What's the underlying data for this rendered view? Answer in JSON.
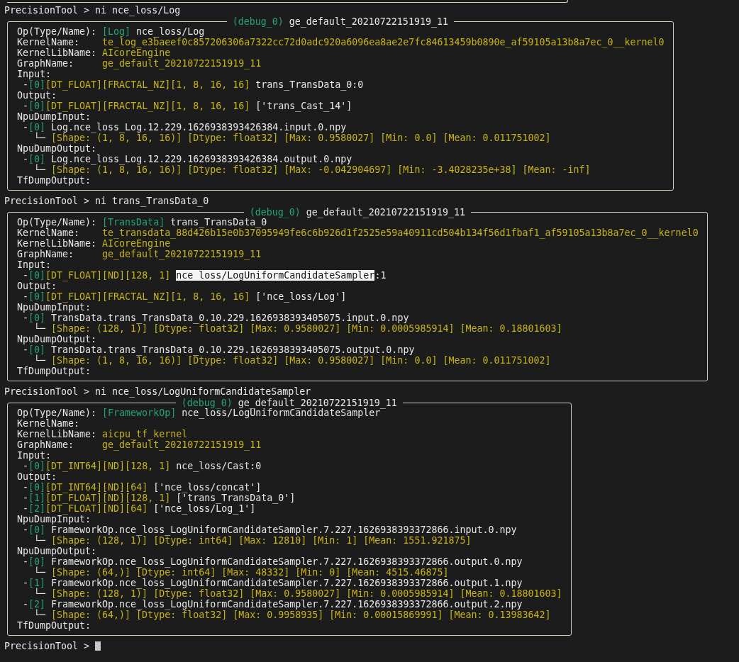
{
  "entries": [
    {
      "line": "PrecisionTool > ni nce_loss/Log",
      "panel": {
        "tag": "(debug_0)",
        "graph": "ge_default_20210722151919_11",
        "lines": [
          {
            "kind": "field",
            "parts": [
              {
                "kind": "label",
                "text": "Op(Type/Name):"
              },
              {
                "kind": "type",
                "text": "[Log]"
              },
              {
                "kind": "text",
                "text": "nce_loss/Log"
              }
            ]
          },
          {
            "kind": "field",
            "parts": [
              {
                "kind": "label",
                "text": "KernelName:"
              },
              {
                "kind": "value",
                "text": "te_log_e3baeef0c857206306a7322cc72d0adc920a6096ea8ae2e7fc84613459b0890e_af59105a13b8a7ec_0__kernel0"
              }
            ]
          },
          {
            "kind": "field",
            "parts": [
              {
                "kind": "label",
                "text": "KernelLibName:"
              },
              {
                "kind": "value",
                "text": "AIcoreEngine"
              }
            ]
          },
          {
            "kind": "field",
            "parts": [
              {
                "kind": "label",
                "text": "GraphName:"
              },
              {
                "kind": "value",
                "text": "ge_default_20210722151919_11"
              }
            ]
          },
          {
            "kind": "heading",
            "parts": [
              {
                "kind": "label",
                "text": "Input:"
              }
            ]
          },
          {
            "kind": "item",
            "parts": [
              {
                "kind": "bullet",
                "text": "-"
              },
              {
                "kind": "index",
                "text": "[0]"
              },
              {
                "kind": "info",
                "text": "[DT_FLOAT][FRACTAL_NZ][1, 8, 16, 16]"
              },
              {
                "kind": "text",
                "text": "trans_TransData_0:0"
              }
            ]
          },
          {
            "kind": "heading",
            "parts": [
              {
                "kind": "label",
                "text": "Output:"
              }
            ]
          },
          {
            "kind": "item",
            "parts": [
              {
                "kind": "bullet",
                "text": "-"
              },
              {
                "kind": "index",
                "text": "[0]"
              },
              {
                "kind": "info",
                "text": "[DT_FLOAT][FRACTAL_NZ][1, 8, 16, 16]"
              },
              {
                "kind": "text",
                "text": "['trans_Cast_14']"
              }
            ]
          },
          {
            "kind": "heading",
            "parts": [
              {
                "kind": "label",
                "text": "NpuDumpInput:"
              }
            ]
          },
          {
            "kind": "item",
            "parts": [
              {
                "kind": "bullet",
                "text": "-"
              },
              {
                "kind": "index",
                "text": "[0]"
              },
              {
                "kind": "text",
                "text": "Log.nce_loss_Log.12.229.1626938393426384.input.0.npy"
              }
            ]
          },
          {
            "kind": "detail",
            "parts": [
              {
                "kind": "branch",
                "text": "└─"
              },
              {
                "kind": "stats",
                "text": "[Shape: (1, 8, 16, 16)] [Dtype: float32] [Max: 0.9580027] [Min: 0.0] [Mean: 0.011751002]"
              }
            ]
          },
          {
            "kind": "heading",
            "parts": [
              {
                "kind": "label",
                "text": "NpuDumpOutput:"
              }
            ]
          },
          {
            "kind": "item",
            "parts": [
              {
                "kind": "bullet",
                "text": "-"
              },
              {
                "kind": "index",
                "text": "[0]"
              },
              {
                "kind": "text",
                "text": "Log.nce_loss_Log.12.229.1626938393426384.output.0.npy"
              }
            ]
          },
          {
            "kind": "detail",
            "parts": [
              {
                "kind": "branch",
                "text": "└─"
              },
              {
                "kind": "stats",
                "text": "[Shape: (1, 8, 16, 16)] [Dtype: float32] [Max: -0.042904697] [Min: -3.4028235e+38] [Mean: -inf]"
              }
            ]
          },
          {
            "kind": "heading",
            "parts": [
              {
                "kind": "label",
                "text": "TfDumpOutput:"
              }
            ]
          }
        ]
      }
    },
    {
      "line": "PrecisionTool > ni trans_TransData_0",
      "panel": {
        "tag": "(debug_0)",
        "graph": "ge_default_20210722151919_11",
        "lines": [
          {
            "kind": "field",
            "parts": [
              {
                "kind": "label",
                "text": "Op(Type/Name):"
              },
              {
                "kind": "type",
                "text": "[TransData]"
              },
              {
                "kind": "text",
                "text": "trans_TransData_0"
              }
            ]
          },
          {
            "kind": "field",
            "parts": [
              {
                "kind": "label",
                "text": "KernelName:"
              },
              {
                "kind": "value",
                "text": "te_transdata_88d426b15e0b37095949fe6c6b926d1f2525e59a40911cd504b134f56d1fbaf1_af59105a13b8a7ec_0__kernel0"
              }
            ]
          },
          {
            "kind": "field",
            "parts": [
              {
                "kind": "label",
                "text": "KernelLibName:"
              },
              {
                "kind": "value",
                "text": "AIcoreEngine"
              }
            ]
          },
          {
            "kind": "field",
            "parts": [
              {
                "kind": "label",
                "text": "GraphName:"
              },
              {
                "kind": "value",
                "text": "ge_default_20210722151919_11"
              }
            ]
          },
          {
            "kind": "heading",
            "parts": [
              {
                "kind": "label",
                "text": "Input:"
              }
            ]
          },
          {
            "kind": "item",
            "parts": [
              {
                "kind": "bullet",
                "text": "-"
              },
              {
                "kind": "index",
                "text": "[0]"
              },
              {
                "kind": "info",
                "text": "[DT_FLOAT][ND][128, 1]"
              },
              {
                "kind": "highlight",
                "text": "nce_loss/LogUniformCandidateSampler"
              },
              {
                "kind": "text",
                "text": ":1"
              }
            ]
          },
          {
            "kind": "heading",
            "parts": [
              {
                "kind": "label",
                "text": "Output:"
              }
            ]
          },
          {
            "kind": "item",
            "parts": [
              {
                "kind": "bullet",
                "text": "-"
              },
              {
                "kind": "index",
                "text": "[0]"
              },
              {
                "kind": "info",
                "text": "[DT_FLOAT][FRACTAL_NZ][1, 8, 16, 16]"
              },
              {
                "kind": "text",
                "text": "['nce_loss/Log']"
              }
            ]
          },
          {
            "kind": "heading",
            "parts": [
              {
                "kind": "label",
                "text": "NpuDumpInput:"
              }
            ]
          },
          {
            "kind": "item",
            "parts": [
              {
                "kind": "bullet",
                "text": "-"
              },
              {
                "kind": "index",
                "text": "[0]"
              },
              {
                "kind": "text",
                "text": "TransData.trans_TransData_0.10.229.1626938393405075.input.0.npy"
              }
            ]
          },
          {
            "kind": "detail",
            "parts": [
              {
                "kind": "branch",
                "text": "└─"
              },
              {
                "kind": "stats",
                "text": "[Shape: (128, 1)] [Dtype: float32] [Max: 0.9580027] [Min: 0.0005985914] [Mean: 0.18801603]"
              }
            ]
          },
          {
            "kind": "heading",
            "parts": [
              {
                "kind": "label",
                "text": "NpuDumpOutput:"
              }
            ]
          },
          {
            "kind": "item",
            "parts": [
              {
                "kind": "bullet",
                "text": "-"
              },
              {
                "kind": "index",
                "text": "[0]"
              },
              {
                "kind": "text",
                "text": "TransData.trans_TransData_0.10.229.1626938393405075.output.0.npy"
              }
            ]
          },
          {
            "kind": "detail",
            "parts": [
              {
                "kind": "branch",
                "text": "└─"
              },
              {
                "kind": "stats",
                "text": "[Shape: (1, 8, 16, 16)] [Dtype: float32] [Max: 0.9580027] [Min: 0.0] [Mean: 0.011751002]"
              }
            ]
          },
          {
            "kind": "heading",
            "parts": [
              {
                "kind": "label",
                "text": "TfDumpOutput:"
              }
            ]
          }
        ]
      }
    },
    {
      "line": "PrecisionTool > ni nce_loss/LogUniformCandidateSampler",
      "panel": {
        "tag": "(debug_0)",
        "graph": "ge_default_20210722151919_11",
        "lines": [
          {
            "kind": "field",
            "parts": [
              {
                "kind": "label",
                "text": "Op(Type/Name):"
              },
              {
                "kind": "type",
                "text": "[FrameworkOp]"
              },
              {
                "kind": "text",
                "text": "nce_loss/LogUniformCandidateSampler"
              }
            ]
          },
          {
            "kind": "field",
            "parts": [
              {
                "kind": "label",
                "text": "KernelName:"
              }
            ]
          },
          {
            "kind": "field",
            "parts": [
              {
                "kind": "label",
                "text": "KernelLibName:"
              },
              {
                "kind": "value",
                "text": "aicpu_tf_kernel"
              }
            ]
          },
          {
            "kind": "field",
            "parts": [
              {
                "kind": "label",
                "text": "GraphName:"
              },
              {
                "kind": "value",
                "text": "ge_default_20210722151919_11"
              }
            ]
          },
          {
            "kind": "heading",
            "parts": [
              {
                "kind": "label",
                "text": "Input:"
              }
            ]
          },
          {
            "kind": "item",
            "parts": [
              {
                "kind": "bullet",
                "text": "-"
              },
              {
                "kind": "index",
                "text": "[0]"
              },
              {
                "kind": "info",
                "text": "[DT_INT64][ND][128, 1]"
              },
              {
                "kind": "text",
                "text": "nce_loss/Cast:0"
              }
            ]
          },
          {
            "kind": "heading",
            "parts": [
              {
                "kind": "label",
                "text": "Output:"
              }
            ]
          },
          {
            "kind": "item",
            "parts": [
              {
                "kind": "bullet",
                "text": "-"
              },
              {
                "kind": "index",
                "text": "[0]"
              },
              {
                "kind": "info",
                "text": "[DT_INT64][ND][64]"
              },
              {
                "kind": "text",
                "text": "['nce_loss/concat']"
              }
            ]
          },
          {
            "kind": "item",
            "parts": [
              {
                "kind": "bullet",
                "text": "-"
              },
              {
                "kind": "index",
                "text": "[1]"
              },
              {
                "kind": "info",
                "text": "[DT_FLOAT][ND][128, 1]"
              },
              {
                "kind": "text",
                "text": "['trans_TransData_0']"
              }
            ]
          },
          {
            "kind": "item",
            "parts": [
              {
                "kind": "bullet",
                "text": "-"
              },
              {
                "kind": "index",
                "text": "[2]"
              },
              {
                "kind": "info",
                "text": "[DT_FLOAT][ND][64]"
              },
              {
                "kind": "text",
                "text": "['nce_loss/Log_1']"
              }
            ]
          },
          {
            "kind": "heading",
            "parts": [
              {
                "kind": "label",
                "text": "NpuDumpInput:"
              }
            ]
          },
          {
            "kind": "item",
            "parts": [
              {
                "kind": "bullet",
                "text": "-"
              },
              {
                "kind": "index",
                "text": "[0]"
              },
              {
                "kind": "text",
                "text": "FrameworkOp.nce_loss_LogUniformCandidateSampler.7.227.1626938393372866.input.0.npy"
              }
            ]
          },
          {
            "kind": "detail",
            "parts": [
              {
                "kind": "branch",
                "text": "└─"
              },
              {
                "kind": "stats",
                "text": "[Shape: (128, 1)] [Dtype: int64] [Max: 12810] [Min: 1] [Mean: 1551.921875]"
              }
            ]
          },
          {
            "kind": "heading",
            "parts": [
              {
                "kind": "label",
                "text": "NpuDumpOutput:"
              }
            ]
          },
          {
            "kind": "item",
            "parts": [
              {
                "kind": "bullet",
                "text": "-"
              },
              {
                "kind": "index",
                "text": "[0]"
              },
              {
                "kind": "text",
                "text": "FrameworkOp.nce_loss_LogUniformCandidateSampler.7.227.1626938393372866.output.0.npy"
              }
            ]
          },
          {
            "kind": "detail",
            "parts": [
              {
                "kind": "branch",
                "text": "└─"
              },
              {
                "kind": "stats",
                "text": "[Shape: (64,)] [Dtype: int64] [Max: 48332] [Min: 0] [Mean: 4515.46875]"
              }
            ]
          },
          {
            "kind": "item",
            "parts": [
              {
                "kind": "bullet",
                "text": "-"
              },
              {
                "kind": "index",
                "text": "[1]"
              },
              {
                "kind": "text",
                "text": "FrameworkOp.nce_loss_LogUniformCandidateSampler.7.227.1626938393372866.output.1.npy"
              }
            ]
          },
          {
            "kind": "detail",
            "parts": [
              {
                "kind": "branch",
                "text": "└─"
              },
              {
                "kind": "stats",
                "text": "[Shape: (128, 1)] [Dtype: float32] [Max: 0.9580027] [Min: 0.0005985914] [Mean: 0.18801603]"
              }
            ]
          },
          {
            "kind": "item",
            "parts": [
              {
                "kind": "bullet",
                "text": "-"
              },
              {
                "kind": "index",
                "text": "[2]"
              },
              {
                "kind": "text",
                "text": "FrameworkOp.nce_loss_LogUniformCandidateSampler.7.227.1626938393372866.output.2.npy"
              }
            ]
          },
          {
            "kind": "detail",
            "parts": [
              {
                "kind": "branch",
                "text": "└─"
              },
              {
                "kind": "stats",
                "text": "[Shape: (64,)] [Dtype: float32] [Max: 0.9958935] [Min: 0.00015869991] [Mean: 0.13983642]"
              }
            ]
          },
          {
            "kind": "heading",
            "parts": [
              {
                "kind": "label",
                "text": "TfDumpOutput:"
              }
            ]
          }
        ]
      }
    },
    {
      "line": "PrecisionTool >",
      "cursor": true
    }
  ]
}
